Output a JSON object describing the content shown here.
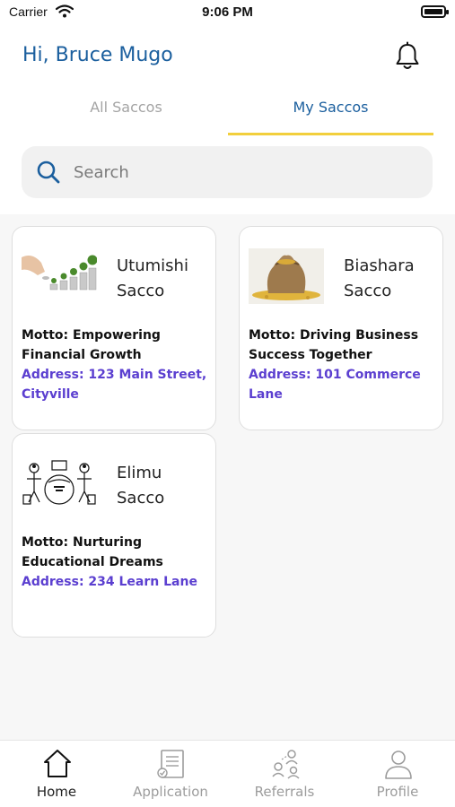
{
  "status_bar": {
    "carrier": "Carrier",
    "time": "9:06 PM"
  },
  "header": {
    "greeting": "Hi, Bruce Mugo"
  },
  "tabs": [
    {
      "label": "All Saccos",
      "active": false
    },
    {
      "label": "My Saccos",
      "active": true
    }
  ],
  "search": {
    "placeholder": "Search",
    "value": ""
  },
  "saccos": [
    {
      "name_line1": "Utumishi",
      "name_line2": "Sacco",
      "motto": "Motto: Empowering Financial Growth",
      "address": "Address: 123 Main Street, Cityville"
    },
    {
      "name_line1": "Biashara",
      "name_line2": "Sacco",
      "motto": "Motto: Driving Business Success Together",
      "address": "Address: 101 Commerce Lane"
    },
    {
      "name_line1": "Elimu",
      "name_line2": "Sacco",
      "motto": "Motto: Nurturing Educational Dreams",
      "address": "Address: 234 Learn Lane"
    }
  ],
  "bottom_nav": [
    {
      "label": "Home",
      "icon": "home-icon",
      "active": true
    },
    {
      "label": "Application",
      "icon": "application-icon",
      "active": false
    },
    {
      "label": "Referrals",
      "icon": "referrals-icon",
      "active": false
    },
    {
      "label": "Profile",
      "icon": "profile-icon",
      "active": false
    }
  ],
  "colors": {
    "primary": "#1b5f9e",
    "tab_indicator": "#f2cf3d",
    "address": "#5b3fd0"
  }
}
